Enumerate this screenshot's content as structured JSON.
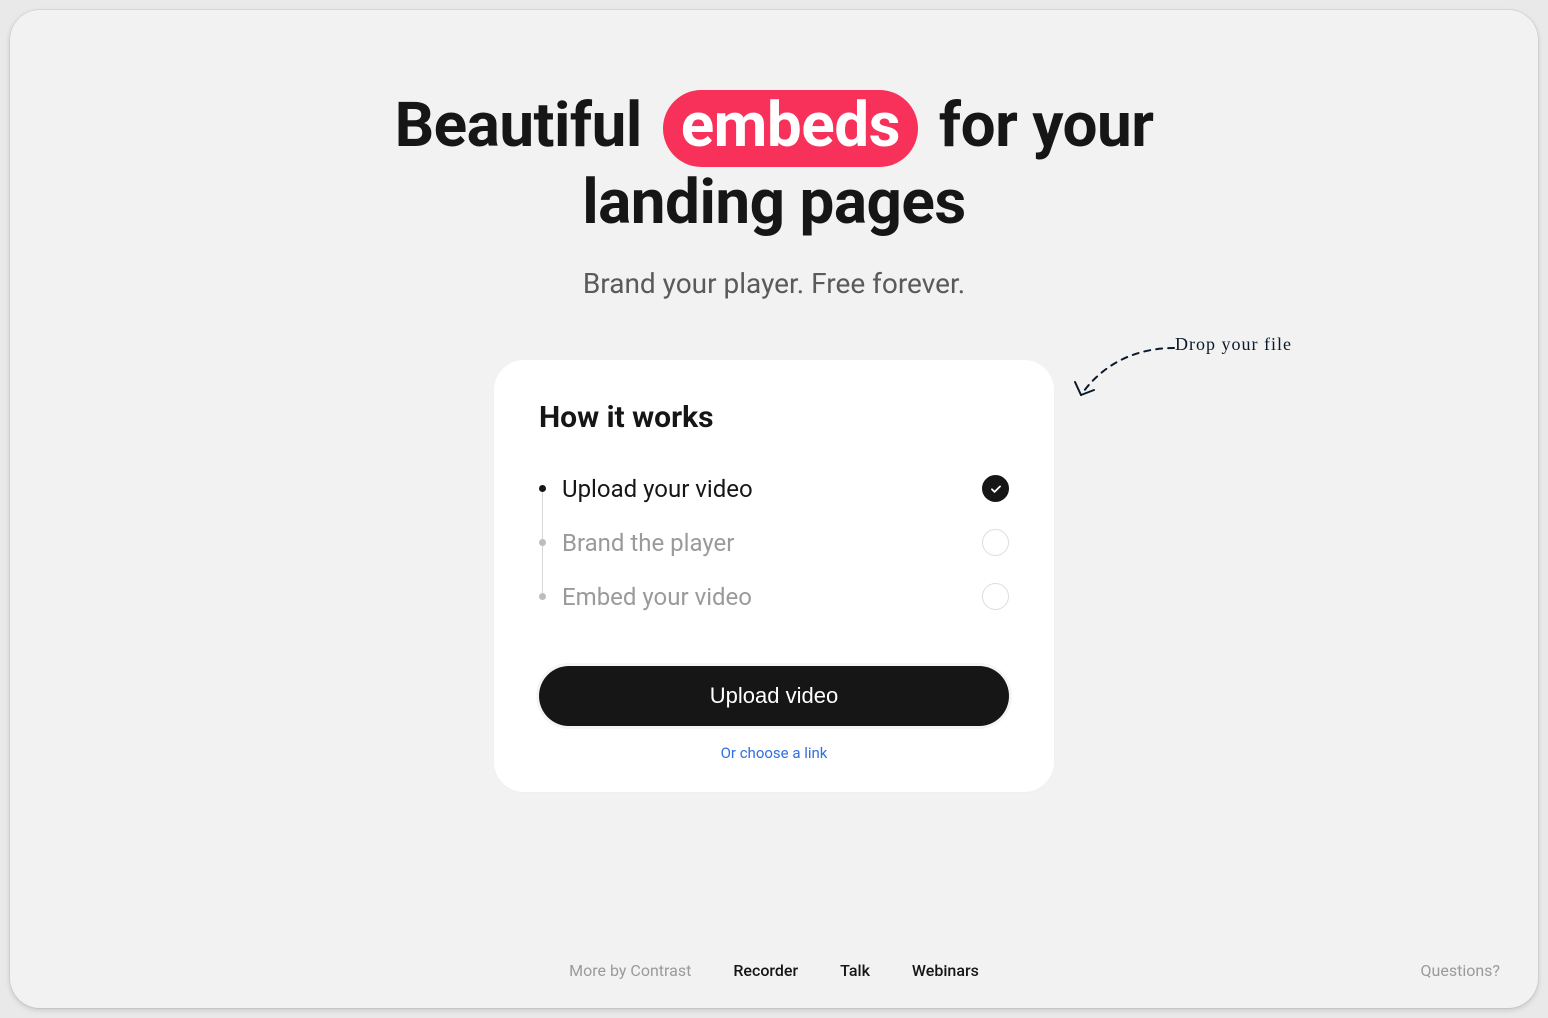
{
  "hero": {
    "title_before": "Beautiful",
    "title_highlight": "embeds",
    "title_after": "for your",
    "title_line2": "landing pages",
    "subtitle": "Brand your player. Free forever."
  },
  "card": {
    "heading": "How it works",
    "steps": [
      {
        "label": "Upload your video",
        "active": true
      },
      {
        "label": "Brand the player",
        "active": false
      },
      {
        "label": "Embed your video",
        "active": false
      }
    ],
    "button_label": "Upload video",
    "link_label": "Or choose a link"
  },
  "annotation": "Drop your file",
  "footer": {
    "label": "More by Contrast",
    "links": [
      {
        "label": "Recorder"
      },
      {
        "label": "Talk"
      },
      {
        "label": "Webinars"
      }
    ],
    "questions": "Questions?"
  },
  "colors": {
    "accent": "#f8315a",
    "text": "#161616",
    "muted": "#9a9a9a",
    "link": "#2f6fe0",
    "bg": "#f2f2f2"
  }
}
